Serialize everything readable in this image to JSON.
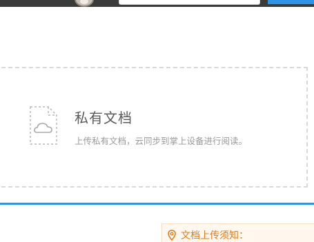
{
  "upload": {
    "title": "私有文档",
    "description": "上传私有文档，云同步到掌上设备进行阅读。",
    "icon": "cloud-document-icon"
  },
  "notice": {
    "title": "文档上传须知：",
    "icon": "location-pin-icon"
  },
  "colors": {
    "accent": "#2f93e2",
    "notice_text": "#e07b1f",
    "topbar": "#3a3a3a"
  }
}
